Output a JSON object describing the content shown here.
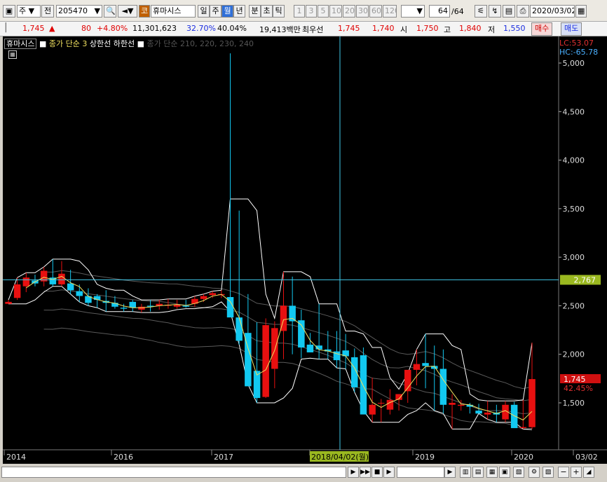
{
  "toolbar": {
    "period_type": "주",
    "all_label": "전",
    "stock_code": "205470",
    "market_badge": "코",
    "stock_name": "휴마시스",
    "periods": [
      "일",
      "주",
      "월",
      "년",
      "분",
      "초",
      "틱"
    ],
    "active_period": "월",
    "intervals": [
      "1",
      "3",
      "5",
      "10",
      "20",
      "30",
      "60",
      "120"
    ],
    "count_value": "64",
    "count_total": "/64",
    "date": "2020/03/02"
  },
  "quote": {
    "price": "1,745",
    "arrow": "▲",
    "change": "80",
    "change_pct": "+4.80%",
    "volume": "11,301,623",
    "turnover_pct": "32.70%",
    "ratio_pct": "40.04%",
    "amount": "19,413백만",
    "best_label": "최우선",
    "ask": "1,745",
    "bid": "1,740",
    "open_label": "시",
    "open": "1,750",
    "high_label": "고",
    "high": "1,840",
    "low_label": "저",
    "low": "1,550",
    "buy_label": "매수",
    "sell_label": "매도"
  },
  "chart_header": {
    "name": "휴마시스",
    "indicator1": "종가 단순 3",
    "indicator2": "상한선",
    "indicator3": "하한선",
    "indicator4": "종가 단순 210, 220, 230, 240",
    "lc": "LC:53.07",
    "hc": "HC:-65.78",
    "current_price_label": "1,745",
    "current_pct_label": "42.45%",
    "crosshair_price": "2,767",
    "crosshair_date": "2018/04/02(월)"
  },
  "chart_data": {
    "type": "candlestick",
    "y_ticks": [
      "5,000",
      "4,500",
      "4,000",
      "3,500",
      "3,000",
      "2,500",
      "2,000",
      "1,500"
    ],
    "x_ticks": [
      "2014",
      "2016",
      "2017",
      "2018/04/02(월)",
      "2019",
      "2020",
      "03/02"
    ],
    "ylim": [
      1150,
      5100
    ],
    "series": [
      {
        "name": "candles",
        "ohlc": [
          [
            2520,
            2560,
            2520,
            2540
          ],
          [
            2580,
            2790,
            2560,
            2720
          ],
          [
            2700,
            2840,
            2640,
            2790
          ],
          [
            2760,
            2820,
            2700,
            2730
          ],
          [
            2750,
            2900,
            2700,
            2860
          ],
          [
            2790,
            2980,
            2700,
            2720
          ],
          [
            2720,
            2960,
            2700,
            2830
          ],
          [
            2730,
            2870,
            2620,
            2660
          ],
          [
            2650,
            2720,
            2540,
            2600
          ],
          [
            2600,
            2680,
            2500,
            2530
          ],
          [
            2600,
            2620,
            2480,
            2560
          ],
          [
            2550,
            2660,
            2440,
            2530
          ],
          [
            2530,
            2600,
            2470,
            2490
          ],
          [
            2480,
            2520,
            2440,
            2470
          ],
          [
            2540,
            2560,
            2440,
            2480
          ],
          [
            2460,
            2520,
            2430,
            2490
          ],
          [
            2500,
            2560,
            2440,
            2490
          ],
          [
            2500,
            2560,
            2460,
            2520
          ],
          [
            2500,
            2570,
            2470,
            2510
          ],
          [
            2490,
            2560,
            2470,
            2510
          ],
          [
            2500,
            2560,
            2480,
            2490
          ],
          [
            2520,
            2600,
            2490,
            2570
          ],
          [
            2570,
            2620,
            2540,
            2600
          ],
          [
            2610,
            2650,
            2580,
            2630
          ],
          [
            2610,
            2660,
            2580,
            2620
          ],
          [
            2590,
            5100,
            2440,
            2380
          ],
          [
            2380,
            3480,
            2100,
            2140
          ],
          [
            2220,
            2620,
            1690,
            1670
          ],
          [
            1830,
            2330,
            1500,
            1550
          ],
          [
            1560,
            2370,
            1550,
            2300
          ],
          [
            1850,
            2340,
            1650,
            2270
          ],
          [
            2240,
            2850,
            1950,
            2500
          ],
          [
            2500,
            2800,
            2000,
            2340
          ],
          [
            2350,
            2460,
            1960,
            2070
          ],
          [
            2100,
            2220,
            2020,
            2020
          ],
          [
            2090,
            2520,
            1950,
            2050
          ],
          [
            2050,
            2240,
            1950,
            2030
          ],
          [
            2030,
            2240,
            1860,
            1940
          ],
          [
            2040,
            2210,
            1850,
            1980
          ],
          [
            1970,
            2060,
            1610,
            1660
          ],
          [
            1990,
            2070,
            1420,
            1380
          ],
          [
            1380,
            1760,
            1300,
            1480
          ],
          [
            1500,
            1540,
            1300,
            1500
          ],
          [
            1430,
            1640,
            1380,
            1530
          ],
          [
            1530,
            1570,
            1420,
            1590
          ],
          [
            1620,
            1800,
            1500,
            1840
          ],
          [
            1840,
            2050,
            1680,
            1900
          ],
          [
            1910,
            2210,
            1650,
            1880
          ],
          [
            1880,
            2090,
            1420,
            1850
          ],
          [
            1850,
            2050,
            1390,
            1480
          ],
          [
            1480,
            1590,
            1230,
            1500
          ],
          [
            1470,
            1530,
            1420,
            1480
          ],
          [
            1480,
            1500,
            1390,
            1460
          ],
          [
            1420,
            1490,
            1390,
            1390
          ],
          [
            1380,
            1520,
            1330,
            1400
          ],
          [
            1400,
            1480,
            1300,
            1380
          ],
          [
            1330,
            1520,
            1300,
            1480
          ],
          [
            1480,
            1510,
            1310,
            1240
          ],
          [
            1240,
            1530,
            1230,
            1250
          ],
          [
            1250,
            2120,
            1230,
            1745
          ]
        ]
      }
    ],
    "crosshair": {
      "value": 2767,
      "date": "2018/04/02(월)"
    }
  },
  "scroll": {
    "arrows": [
      "◀",
      "▶"
    ]
  }
}
